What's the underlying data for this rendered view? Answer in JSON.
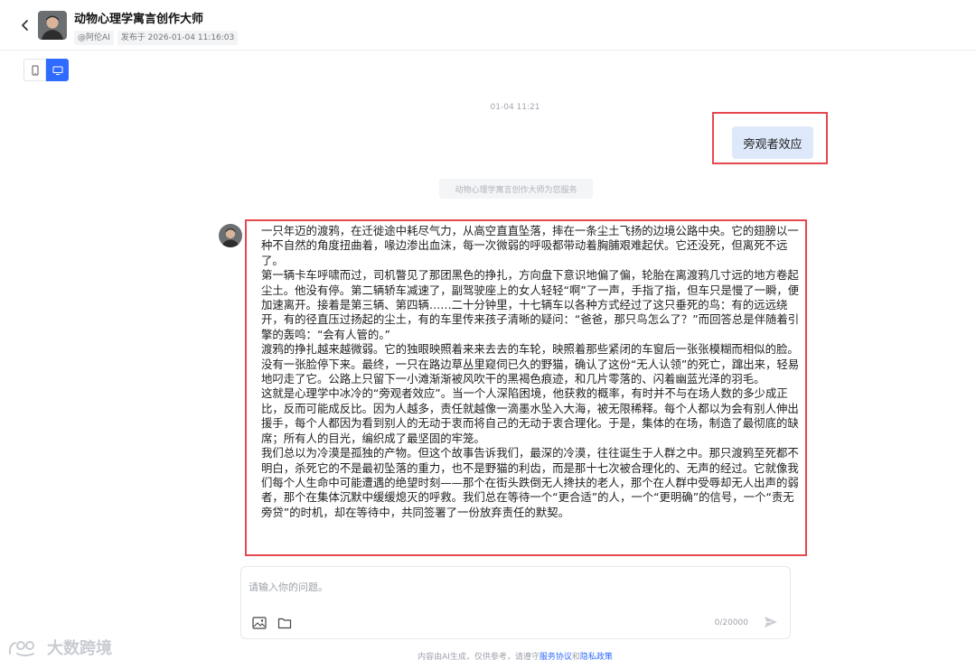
{
  "header": {
    "title": "动物心理学寓言创作大师",
    "author": "@阿伦AI",
    "published": "发布于 2026-01-04 11:16:03"
  },
  "chat": {
    "timestamp": "01-04 11:21",
    "user_message": "旁观者效应",
    "service_note": "动物心理学寓言创作大师为您服务",
    "reply_paragraphs": [
      "一只年迈的渡鸦，在迁徙途中耗尽气力，从高空直直坠落，摔在一条尘土飞扬的边境公路中央。它的翅膀以一种不自然的角度扭曲着，喙边渗出血沫，每一次微弱的呼吸都带动着胸脯艰难起伏。它还没死，但离死不远了。",
      "第一辆卡车呼啸而过，司机瞥见了那团黑色的挣扎，方向盘下意识地偏了偏，轮胎在离渡鸦几寸远的地方卷起尘土。他没有停。第二辆轿车减速了，副驾驶座上的女人轻轻“啊”了一声，手指了指，但车只是慢了一瞬，便加速离开。接着是第三辆、第四辆……二十分钟里，十七辆车以各种方式经过了这只垂死的鸟：有的远远绕开，有的径直压过扬起的尘土，有的车里传来孩子清晰的疑问：“爸爸，那只鸟怎么了？”而回答总是伴随着引擎的轰鸣：“会有人管的。”",
      "渡鸦的挣扎越来越微弱。它的独眼映照着来来去去的车轮，映照着那些紧闭的车窗后一张张模糊而相似的脸。没有一张脸停下来。最终，一只在路边草丛里窥伺已久的野猫，确认了这份“无人认领”的死亡，蹿出来，轻易地叼走了它。公路上只留下一小滩渐渐被风吹干的黑褐色痕迹，和几片零落的、闪着幽蓝光泽的羽毛。",
      "这就是心理学中冰冷的“旁观者效应”。当一个人深陷困境，他获救的概率，有时并不与在场人数的多少成正比，反而可能成反比。因为人越多，责任就越像一滴墨水坠入大海，被无限稀释。每个人都以为会有别人伸出援手，每个人都因为看到别人的无动于衷而将自己的无动于衷合理化。于是，集体的在场，制造了最彻底的缺席；所有人的目光，编织成了最坚固的牢笼。",
      "我们总以为冷漠是孤独的产物。但这个故事告诉我们，最深的冷漠，往往诞生于人群之中。那只渡鸦至死都不明白，杀死它的不是最初坠落的重力，也不是野猫的利齿，而是那十七次被合理化的、无声的经过。它就像我们每个人生命中可能遭遇的绝望时刻——那个在街头跌倒无人搀扶的老人，那个在人群中受辱却无人出声的弱者，那个在集体沉默中缓缓熄灭的呼救。我们总在等待一个“更合适”的人，一个“更明确”的信号，一个“责无旁贷”的时机，却在等待中，共同签署了一份放弃责任的默契。"
    ]
  },
  "input": {
    "placeholder": "请输入你的问题。",
    "char_count": "0/20000"
  },
  "footer": {
    "prefix": "内容由AI生成，仅供参考，请遵守",
    "service_link": "服务协议",
    "and": "和",
    "privacy_link": "隐私政策"
  },
  "watermark": {
    "text": "大数跨境"
  },
  "colors": {
    "accent": "#2f6bff",
    "highlight_border": "#e5484d",
    "user_bubble": "#dde8fb"
  }
}
